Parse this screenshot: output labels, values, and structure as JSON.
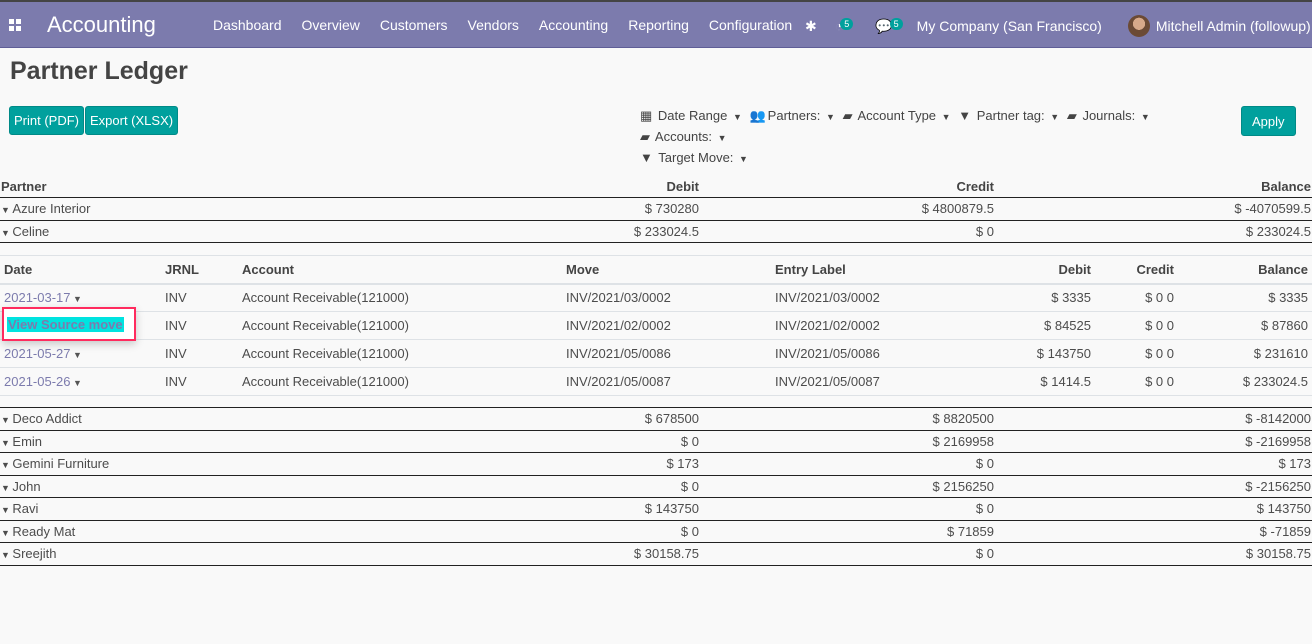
{
  "nav": {
    "app": "Accounting",
    "menu": [
      "Dashboard",
      "Overview",
      "Customers",
      "Vendors",
      "Accounting",
      "Reporting",
      "Configuration"
    ],
    "activity_count": "5",
    "message_count": "5",
    "company": "My Company (San Francisco)",
    "user": "Mitchell Admin (followup)"
  },
  "page": {
    "title": "Partner Ledger",
    "print": "Print (PDF)",
    "export": "Export (XLSX)",
    "apply": "Apply"
  },
  "filters": [
    "Date Range",
    "Partners:",
    "Account Type",
    "Partner tag:",
    "Journals:",
    "Accounts:",
    "Target Move:"
  ],
  "main_headers": [
    "Partner",
    "Debit",
    "Credit",
    "Balance"
  ],
  "partners": [
    [
      "Azure Interior",
      "$ 730280",
      "$ 4800879.5",
      "$ -4070599.5"
    ],
    [
      "Celine",
      "$ 233024.5",
      "$ 0",
      "$ 233024.5"
    ],
    [
      "Deco Addict",
      "$ 678500",
      "$ 8820500",
      "$ -8142000"
    ],
    [
      "Emin",
      "$ 0",
      "$ 2169958",
      "$ -2169958"
    ],
    [
      "Gemini Furniture",
      "$ 173",
      "$ 0",
      "$ 173"
    ],
    [
      "John",
      "$ 0",
      "$ 2156250",
      "$ -2156250"
    ],
    [
      "Ravi",
      "$ 143750",
      "$ 0",
      "$ 143750"
    ],
    [
      "Ready Mat",
      "$ 0",
      "$ 71859",
      "$ -71859"
    ],
    [
      "Sreejith",
      "$ 30158.75",
      "$ 0",
      "$ 30158.75"
    ]
  ],
  "detail_headers": [
    "Date",
    "JRNL",
    "Account",
    "Move",
    "Entry Label",
    "Debit",
    "Credit",
    "Balance"
  ],
  "details": [
    [
      "2021-03-17",
      "INV",
      "Account Receivable(121000)",
      "INV/2021/03/0002",
      "INV/2021/03/0002",
      "$ 3335",
      "$ 0 0",
      "$ 3335"
    ],
    [
      "",
      "INV",
      "Account Receivable(121000)",
      "INV/2021/02/0002",
      "INV/2021/02/0002",
      "$ 84525",
      "$ 0 0",
      "$ 87860"
    ],
    [
      "2021-05-27",
      "INV",
      "Account Receivable(121000)",
      "INV/2021/05/0086",
      "INV/2021/05/0086",
      "$ 143750",
      "$ 0 0",
      "$ 231610"
    ],
    [
      "2021-05-26",
      "INV",
      "Account Receivable(121000)",
      "INV/2021/05/0087",
      "INV/2021/05/0087",
      "$ 1414.5",
      "$ 0 0",
      "$ 233024.5"
    ]
  ],
  "popup": "View Source move"
}
